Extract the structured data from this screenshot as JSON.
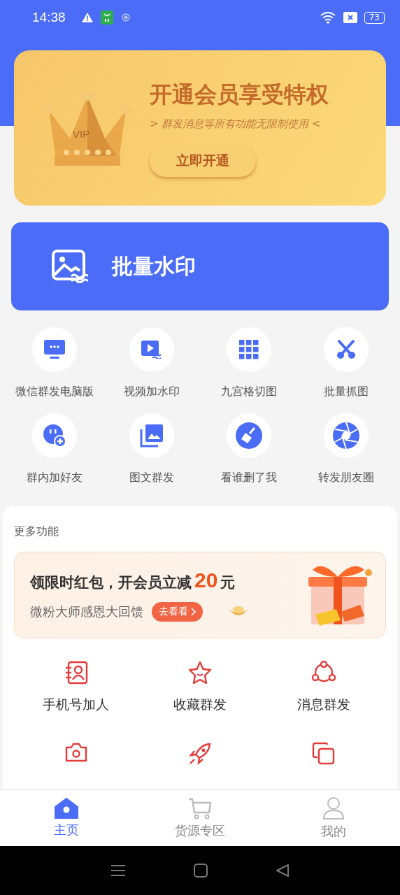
{
  "status_bar": {
    "time": "14:38",
    "battery": "73"
  },
  "vip_banner": {
    "crown_label": "VIP",
    "title": "开通会员享受特权",
    "subtitle": "> 群发消息等所有功能无限制使用 <",
    "button": "立即开通"
  },
  "feature_card": {
    "label": "批量水印"
  },
  "tools": [
    {
      "label": "微信群发电脑版",
      "kind": "monitor"
    },
    {
      "label": "视频加水印",
      "kind": "video"
    },
    {
      "label": "九宫格切图",
      "kind": "grid"
    },
    {
      "label": "批量抓图",
      "kind": "scissors"
    },
    {
      "label": "群内加好友",
      "kind": "add-friend"
    },
    {
      "label": "图文群发",
      "kind": "gallery"
    },
    {
      "label": "看谁删了我",
      "kind": "broom"
    },
    {
      "label": "转发朋友圈",
      "kind": "aperture"
    }
  ],
  "more": {
    "title": "更多功能",
    "promo": {
      "headline": "领限时红包，开会员立减",
      "amount": "20",
      "unit": "元",
      "subtitle": "微粉大师感恩大回馈",
      "button": "去看看"
    },
    "items": [
      {
        "label": "手机号加人",
        "kind": "contact-book"
      },
      {
        "label": "收藏群发",
        "kind": "star"
      },
      {
        "label": "消息群发",
        "kind": "share"
      },
      {
        "kind": "camera"
      },
      {
        "kind": "rocket"
      },
      {
        "kind": "copy"
      }
    ]
  },
  "bottom_nav": [
    {
      "label": "主页",
      "kind": "home",
      "selected": true
    },
    {
      "label": "货源专区",
      "kind": "cart",
      "selected": false
    },
    {
      "label": "我的",
      "kind": "person",
      "selected": false
    }
  ]
}
